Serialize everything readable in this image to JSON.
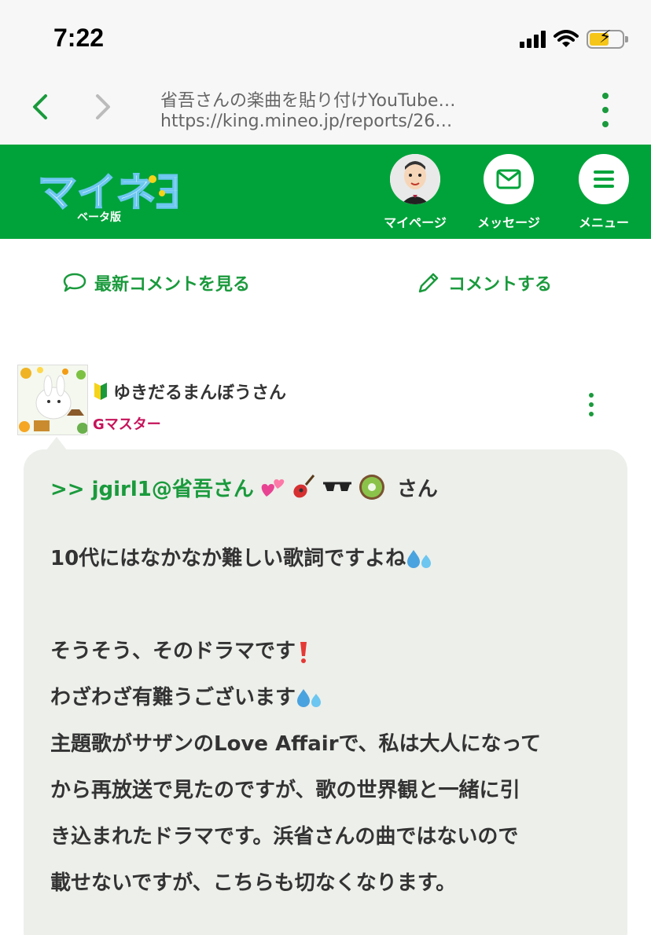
{
  "status_bar": {
    "time": "7:22"
  },
  "browser": {
    "title": "省吾さんの楽曲を貼り付けYouTube…",
    "url": "https://king.mineo.jp/reports/26…"
  },
  "header": {
    "logo_text": "マイネ王",
    "logo_sub": "ベータ版",
    "mypage_label": "マイページ",
    "message_label": "メッセージ",
    "menu_label": "メニュー",
    "brand_color": "#00a33a"
  },
  "actions": {
    "latest_comments": "最新コメントを見る",
    "comment": "コメントする"
  },
  "comment": {
    "author": "ゆきだるまんぼうさん",
    "rank": "Gマスター",
    "reply_to": ">> jgirl1@省吾さん",
    "reply_suffix": "さん",
    "line1": "10代にはなかなか難しい歌詞ですよね",
    "line2": "そうそう、そのドラマです",
    "line3": "わざわざ有難うございます",
    "line4": "主題歌がサザンのLove Affairで、私は大人になって",
    "line5": "から再放送で見たのですが、歌の世界観と一緒に引",
    "line6": "き込まれたドラマです。浜省さんの曲ではないので",
    "line7": "載せないですが、こちらも切なくなります。"
  }
}
